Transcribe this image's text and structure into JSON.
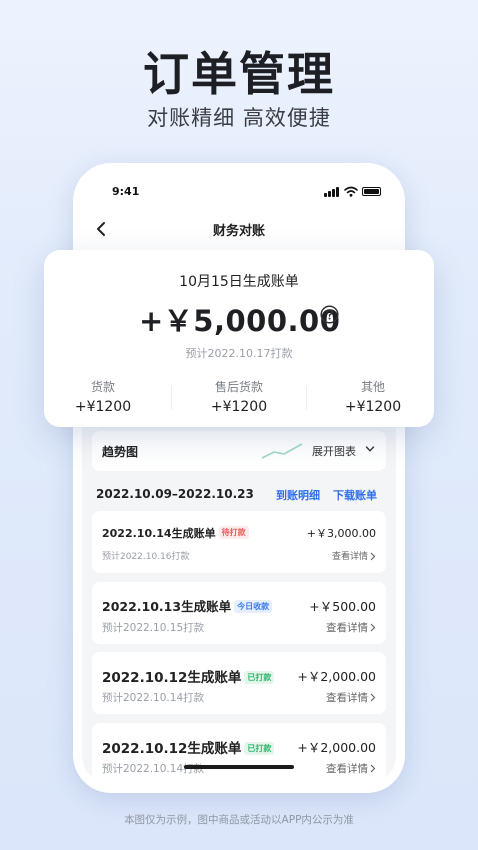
{
  "hero": {
    "title": "订单管理",
    "subtitle": "对账精细 高效便捷"
  },
  "status_bar": {
    "time": "9:41"
  },
  "nav": {
    "title": "财务对账"
  },
  "summary": {
    "date_label": "10月15日生成账单",
    "amount": "+￥5,000.00",
    "note": "预计2022.10.17打款",
    "breakdown": [
      {
        "label": "货款",
        "value": "+¥1200"
      },
      {
        "label": "售后货款",
        "value": "+¥1200"
      },
      {
        "label": "其他",
        "value": "+¥1200"
      }
    ]
  },
  "trend": {
    "label": "趋势图",
    "toggle": "展开图表"
  },
  "period": {
    "range": "2022.10.09–2022.10.23",
    "detail_link": "到账明细",
    "download_link": "下载账单"
  },
  "bills": [
    {
      "title": "2022.10.14生成账单",
      "tag": "待打款",
      "tag_type": "pending",
      "amount": "+￥3,000.00",
      "sub": "预计2022.10.16打款",
      "link": "查看详情"
    },
    {
      "title": "2022.10.13生成账单",
      "tag": "今日收款",
      "tag_type": "today",
      "amount": "+￥500.00",
      "sub": "预计2022.10.15打款",
      "link": "查看详情"
    },
    {
      "title": "2022.10.12生成账单",
      "tag": "已打款",
      "tag_type": "paid",
      "amount": "+￥2,000.00",
      "sub": "预计2022.10.14打款",
      "link": "查看详情"
    },
    {
      "title": "2022.10.12生成账单",
      "tag": "已打款",
      "tag_type": "paid",
      "amount": "+￥2,000.00",
      "sub": "预计2022.10.14打款",
      "link": "查看详情"
    }
  ],
  "footnote": "本图仅为示例，图中商品或活动以APP内公示为准",
  "colors": {
    "accent": "#2f6fe8",
    "pending": "#ef5a5a",
    "today": "#3b7bf0",
    "paid": "#2db36b"
  }
}
